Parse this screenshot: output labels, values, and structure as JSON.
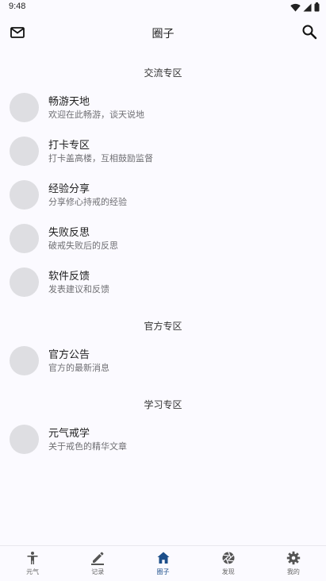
{
  "status_bar": {
    "time": "9:48"
  },
  "app_bar": {
    "title": "圈子"
  },
  "sections": [
    {
      "title": "交流专区",
      "items": [
        {
          "name": "畅游天地",
          "desc": "欢迎在此畅游，谈天说地"
        },
        {
          "name": "打卡专区",
          "desc": "打卡盖高楼，互相鼓励监督"
        },
        {
          "name": "经验分享",
          "desc": "分享修心持戒的经验"
        },
        {
          "name": "失败反思",
          "desc": "破戒失败后的反思"
        },
        {
          "name": "软件反馈",
          "desc": "发表建议和反馈"
        }
      ]
    },
    {
      "title": "官方专区",
      "items": [
        {
          "name": "官方公告",
          "desc": "官方的最新消息"
        }
      ]
    },
    {
      "title": "学习专区",
      "items": [
        {
          "name": "元气戒学",
          "desc": "关于戒色的精华文章"
        }
      ]
    }
  ],
  "bottom_nav": [
    {
      "label": "元气",
      "icon": "person-icon"
    },
    {
      "label": "记录",
      "icon": "pen-icon"
    },
    {
      "label": "圈子",
      "icon": "home-icon",
      "active": true
    },
    {
      "label": "发现",
      "icon": "aperture-icon"
    },
    {
      "label": "我的",
      "icon": "gear-icon"
    }
  ],
  "colors": {
    "background": "#fbfaff",
    "active_nav": "#1c4e8a",
    "avatar": "#dedee2"
  }
}
